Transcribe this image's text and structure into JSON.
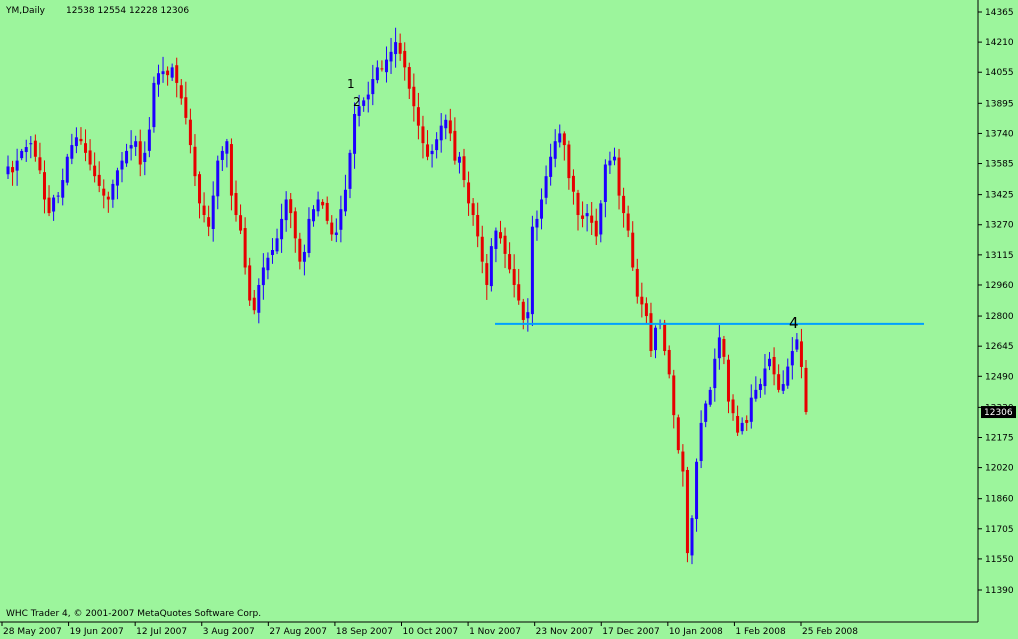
{
  "header": {
    "symbol": "YM,Daily",
    "ohlc": "12538 12554 12228 12306"
  },
  "footer": {
    "copyright": "WHC Trader 4, © 2001-2007 MetaQuotes Software Corp."
  },
  "price_label": "12306",
  "colors": {
    "background": "#9cf59c",
    "bull": "#1e00ff",
    "bear": "#e60000",
    "level_line": "#00a0ff",
    "axis": "#000000"
  },
  "annotations": [
    {
      "text": "1",
      "x": "2007-09-26",
      "y": 14020
    },
    {
      "text": "2",
      "x": "2007-09-27",
      "y": 13950
    },
    {
      "text": "4",
      "x": "2008-02-29",
      "y": 12860
    }
  ],
  "chart_data": {
    "type": "candlestick",
    "title": "YM,Daily",
    "ylim": [
      11390,
      14365
    ],
    "y_ticks": [
      14365,
      14210,
      14055,
      13895,
      13740,
      13585,
      13425,
      13270,
      13115,
      12960,
      12800,
      12645,
      12490,
      12330,
      12175,
      12020,
      11860,
      11705,
      11550,
      11390
    ],
    "x_ticks": [
      "28 May 2007",
      "19 Jun 2007",
      "12 Jul 2007",
      "3 Aug 2007",
      "27 Aug 2007",
      "18 Sep 2007",
      "10 Oct 2007",
      "1 Nov 2007",
      "23 Nov 2007",
      "17 Dec 2007",
      "10 Jan 2008",
      "1 Feb 2008",
      "25 Feb 2008"
    ],
    "horizontal_line": {
      "y": 12760,
      "from": "2007-11-13",
      "to": "2008-04-03"
    },
    "last_price": 12306,
    "grid": false,
    "closes": [
      13570,
      13540,
      13600,
      13650,
      13670,
      13690,
      13620,
      13550,
      13400,
      13330,
      13410,
      13420,
      13500,
      13620,
      13680,
      13720,
      13700,
      13640,
      13580,
      13520,
      13470,
      13420,
      13400,
      13480,
      13550,
      13600,
      13650,
      13680,
      13700,
      13580,
      13640,
      13760,
      14000,
      14050,
      14060,
      14040,
      14080,
      14000,
      13920,
      13820,
      13680,
      13520,
      13380,
      13320,
      13260,
      13420,
      13600,
      13650,
      13700,
      13420,
      13320,
      13240,
      13050,
      12880,
      12830,
      12960,
      13050,
      13100,
      13140,
      13200,
      13300,
      13400,
      13330,
      13200,
      13080,
      13130,
      13300,
      13350,
      13400,
      13370,
      13290,
      13220,
      13230,
      13350,
      13450,
      13640,
      13840,
      13880,
      13910,
      13940,
      14020,
      14080,
      14070,
      14120,
      14160,
      14210,
      14150,
      14080,
      13970,
      13880,
      13780,
      13690,
      13620,
      13650,
      13710,
      13780,
      13810,
      13740,
      13600,
      13620,
      13500,
      13380,
      13320,
      13210,
      13080,
      12960,
      13160,
      13240,
      13200,
      13120,
      13040,
      12960,
      12880,
      12780,
      12820,
      13260,
      13300,
      13400,
      13520,
      13620,
      13700,
      13740,
      13680,
      13510,
      13440,
      13320,
      13300,
      13330,
      13280,
      13210,
      13380,
      13580,
      13600,
      13620,
      13420,
      13330,
      13240,
      13050,
      12900,
      12860,
      12800,
      12620,
      12740,
      12760,
      12620,
      12500,
      12290,
      12110,
      12000,
      11580,
      11760,
      12050,
      12250,
      12350,
      12420,
      12580,
      12690,
      12590,
      12360,
      12300,
      12200,
      12250,
      12250,
      12380,
      12420,
      12450,
      12530,
      12580,
      12500,
      12420,
      12450,
      12540,
      12620,
      12680,
      12538,
      12306
    ]
  }
}
